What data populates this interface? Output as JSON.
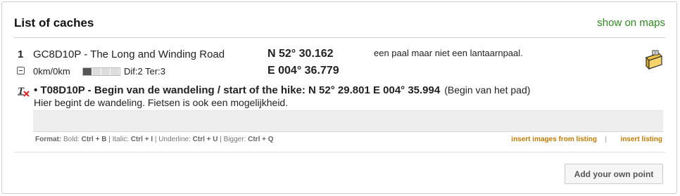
{
  "header": {
    "title": "List of caches",
    "show_on_maps": "show on maps"
  },
  "cache": {
    "number": "1",
    "name": "GC8D10P - The Long and Winding Road",
    "lat": "N 52° 30.162",
    "lon": "E 004° 36.779",
    "description": "een paal maar niet een lantaarnpaal.",
    "distance": "0km/0km",
    "bar_level": 1,
    "bar_segments": 4,
    "dif_ter": "Dif:2 Ter:3"
  },
  "waypoint": {
    "title": "• T08D10P - Begin van de wandeling / start of the hike: N 52° 29.801 E 004° 35.994",
    "note": "(Begin van het pad)",
    "text": "Hier begint de wandeling. Fietsen is ook een mogelijkheid."
  },
  "format": {
    "label": "Format:",
    "bold": "Bold:",
    "bold_key": "Ctrl + B",
    "italic": "Italic:",
    "italic_key": "Ctrl + I",
    "underline": "Underline:",
    "underline_key": "Ctrl + U",
    "bigger": "Bigger:",
    "bigger_key": "Ctrl + Q",
    "insert_images": "insert images from listing",
    "separator": "|",
    "insert_listing": "insert listing"
  },
  "actions": {
    "add_point": "Add your own point"
  },
  "colors": {
    "link_green": "#2d8a1f",
    "insert_orange": "#c47a00"
  }
}
